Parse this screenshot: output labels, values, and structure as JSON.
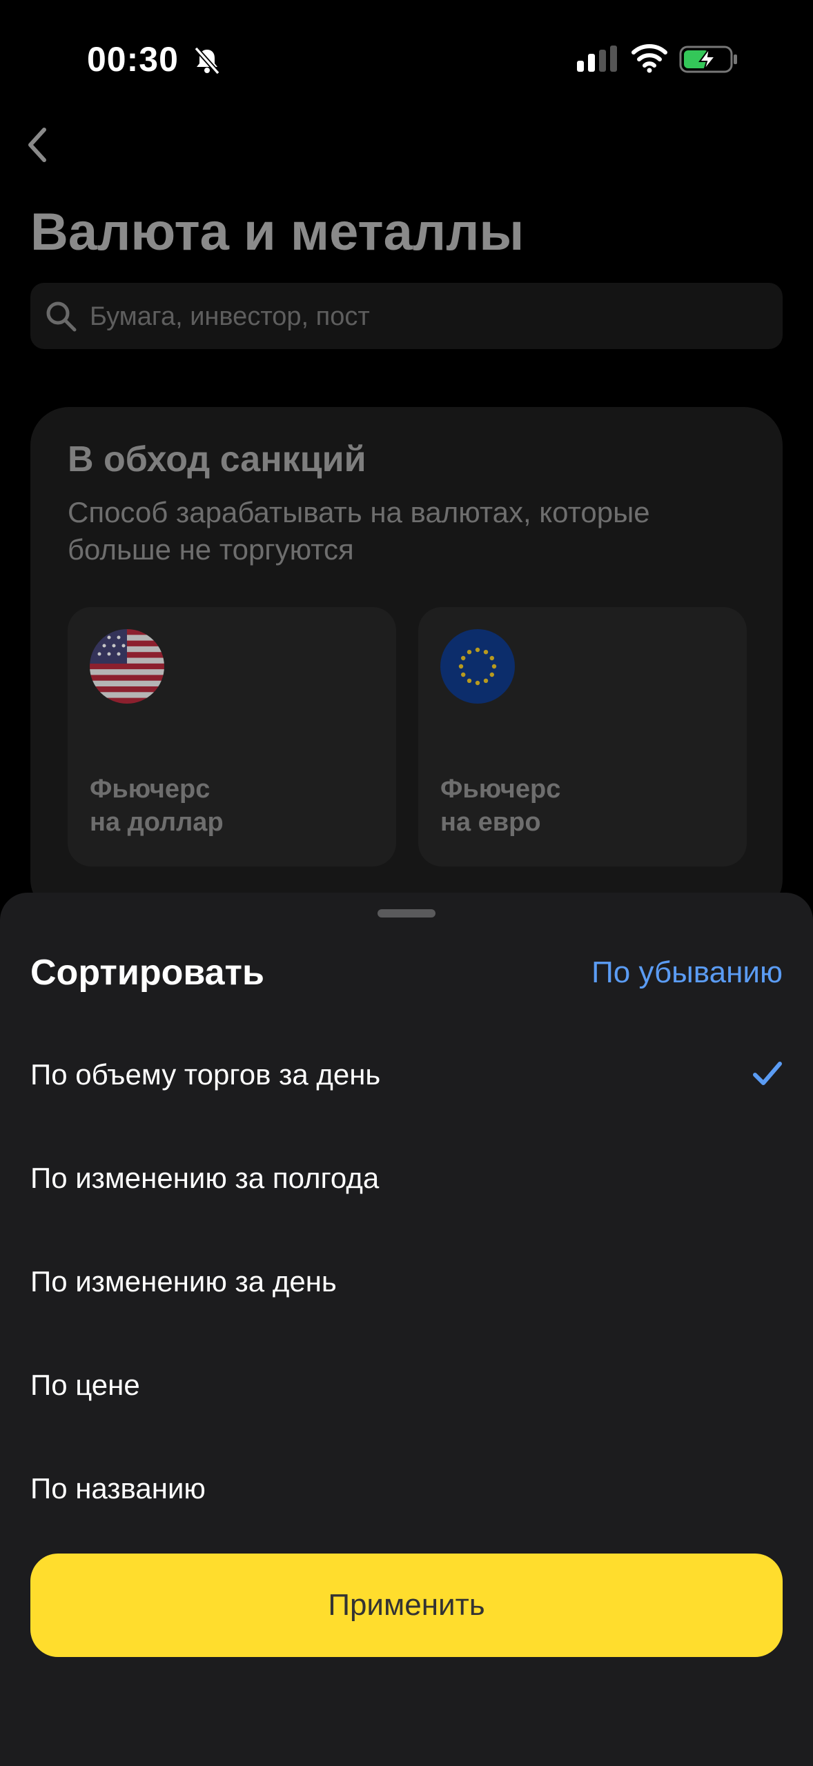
{
  "status_bar": {
    "time": "00:30"
  },
  "page": {
    "title": "Валюта и металлы",
    "search_placeholder": "Бумага, инвестор, пост"
  },
  "promo": {
    "title": "В обход санкций",
    "subtitle": "Способ зарабатывать на валютах, которые больше не торгуются",
    "cards": [
      {
        "label_line1": "Фьючерс",
        "label_line2": "на доллар",
        "flag": "us-flag-icon"
      },
      {
        "label_line1": "Фьючерс",
        "label_line2": "на евро",
        "flag": "eu-flag-icon"
      }
    ]
  },
  "sort_sheet": {
    "title": "Сортировать",
    "order_label": "По убыванию",
    "options": [
      {
        "label": "По объему торгов за день",
        "selected": true
      },
      {
        "label": "По изменению за полгода",
        "selected": false
      },
      {
        "label": "По изменению за день",
        "selected": false
      },
      {
        "label": "По цене",
        "selected": false
      },
      {
        "label": "По названию",
        "selected": false
      }
    ],
    "apply_label": "Применить"
  },
  "colors": {
    "accent_blue": "#5b9cf4",
    "apply_yellow": "#ffdd2d",
    "sheet_bg": "#1c1c1e",
    "battery_green": "#34c759"
  }
}
